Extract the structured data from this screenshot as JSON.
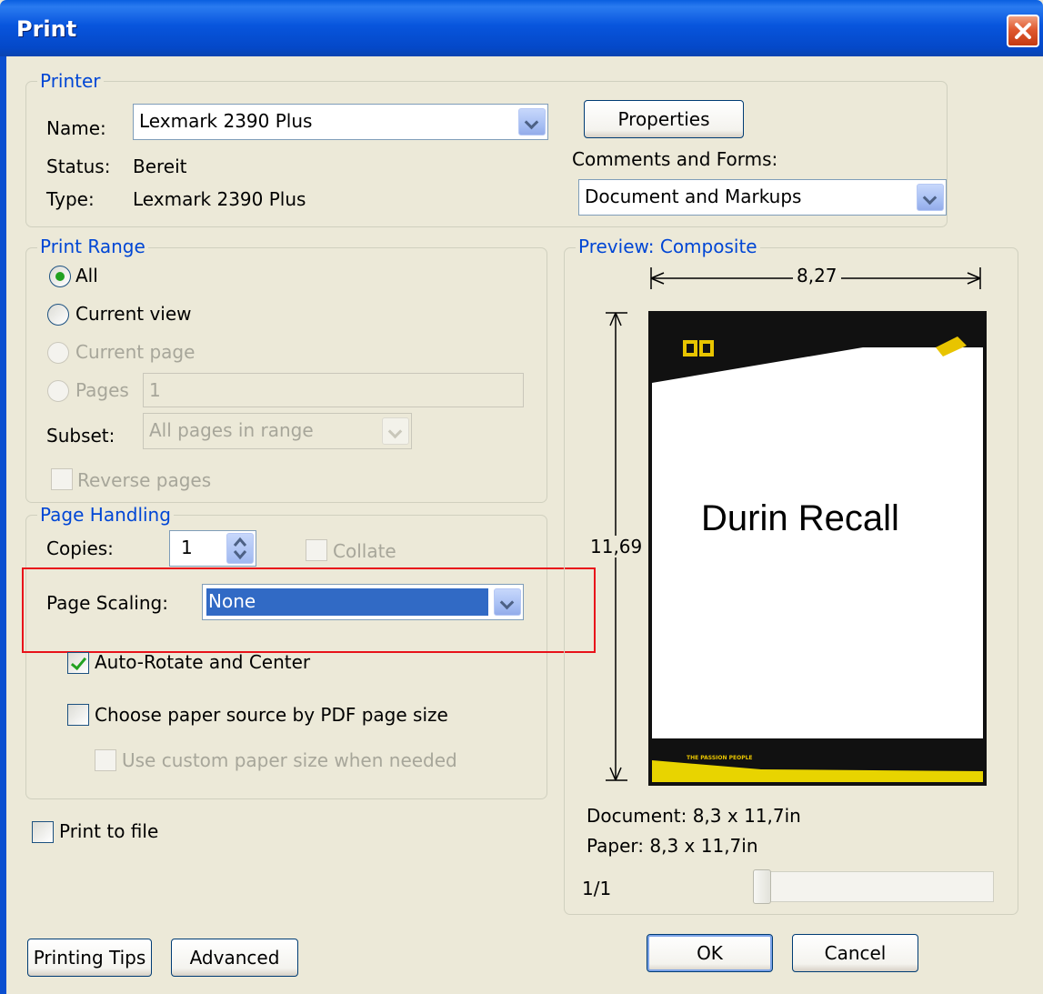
{
  "window": {
    "title": "Print"
  },
  "printer": {
    "legend": "Printer",
    "name_label": "Name:",
    "name_value": "Lexmark 2390 Plus",
    "status_label": "Status:",
    "status_value": "Bereit",
    "type_label": "Type:",
    "type_value": "Lexmark 2390 Plus",
    "properties_button": "Properties",
    "comments_label": "Comments and Forms:",
    "comments_value": "Document and Markups"
  },
  "print_range": {
    "legend": "Print Range",
    "all": "All",
    "current_view": "Current view",
    "current_page": "Current page",
    "pages": "Pages",
    "pages_value": "1",
    "subset_label": "Subset:",
    "subset_value": "All pages in range",
    "reverse_pages": "Reverse pages"
  },
  "page_handling": {
    "legend": "Page Handling",
    "copies_label": "Copies:",
    "copies_value": "1",
    "collate": "Collate",
    "scaling_label": "Page Scaling:",
    "scaling_value": "None",
    "auto_rotate": "Auto-Rotate and Center",
    "choose_paper": "Choose paper source by PDF page size",
    "custom_paper": "Use custom paper size when needed"
  },
  "print_to_file": "Print to file",
  "preview": {
    "legend": "Preview: Composite",
    "width": "8,27",
    "height": "11,69",
    "doc_title": "Durin Recall",
    "footer_tag": "THE PASSION PEOPLE",
    "document": "Document: 8,3 x 11,7in",
    "paper": "Paper: 8,3 x 11,7in",
    "page_counter": "1/1"
  },
  "buttons": {
    "printing_tips": "Printing Tips",
    "advanced": "Advanced",
    "ok": "OK",
    "cancel": "Cancel"
  }
}
